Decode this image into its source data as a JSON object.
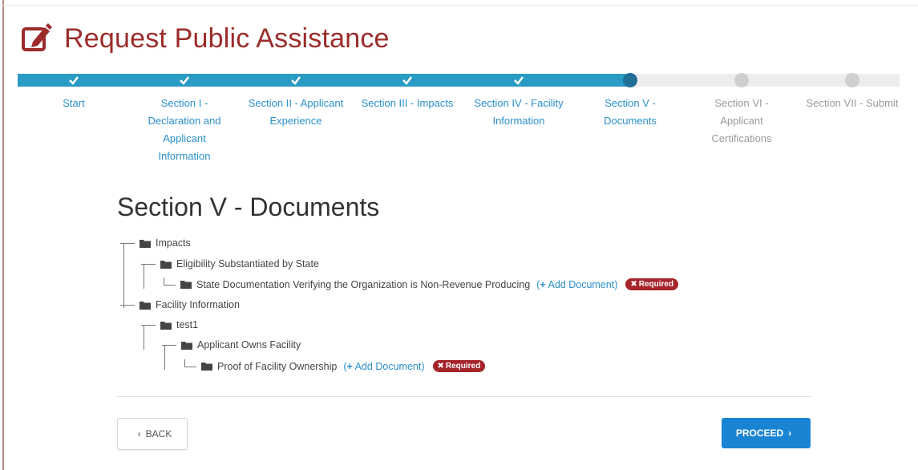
{
  "header": {
    "title": "Request Public Assistance",
    "icon": "edit-icon",
    "color": "#9b2c2a"
  },
  "progress": {
    "fill_color": "#2a9bc5",
    "steps": [
      {
        "label_lines": [
          "Start"
        ],
        "status": "done"
      },
      {
        "label_lines": [
          "Section I -",
          "Declaration and",
          "Applicant",
          "Information"
        ],
        "status": "done"
      },
      {
        "label_lines": [
          "Section II - Applicant",
          "Experience"
        ],
        "status": "done"
      },
      {
        "label_lines": [
          "Section III - Impacts"
        ],
        "status": "done"
      },
      {
        "label_lines": [
          "Section IV - Facility",
          "Information"
        ],
        "status": "done"
      },
      {
        "label_lines": [
          "Section V -",
          "Documents"
        ],
        "status": "current"
      },
      {
        "label_lines": [
          "Section VI -",
          "Applicant",
          "Certifications"
        ],
        "status": "todo"
      },
      {
        "label_lines": [
          "Section VII - Submit"
        ],
        "status": "todo"
      }
    ]
  },
  "section": {
    "title": "Section V - Documents"
  },
  "tree": [
    {
      "label": "Impacts",
      "depth": 0
    },
    {
      "label": "Eligibility Substantiated by State",
      "depth": 1
    },
    {
      "label": "State Documentation Verifying the Organization is Non-Revenue Producing",
      "depth": 2,
      "leaf": true,
      "add": "Add Document",
      "required": "Required"
    },
    {
      "label": "Facility Information",
      "depth": 0
    },
    {
      "label": "test1",
      "depth": 1
    },
    {
      "label": "Applicant Owns Facility",
      "depth": 2
    },
    {
      "label": "Proof of Facility Ownership",
      "depth": 3,
      "leaf": true,
      "add": "Add Document",
      "required": "Required"
    }
  ],
  "buttons": {
    "back_label": "BACK",
    "proceed_label": "PROCEED"
  },
  "colors": {
    "accent": "#2a8fc9",
    "required": "#a5242a",
    "primary_button": "#1a84d4"
  }
}
